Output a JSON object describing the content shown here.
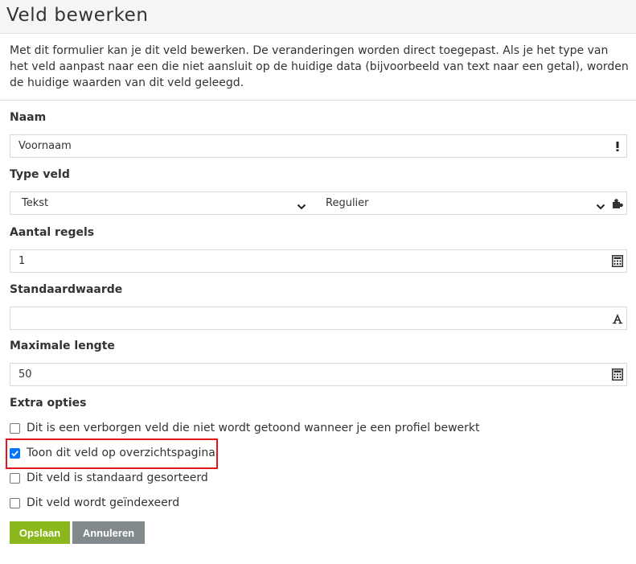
{
  "page": {
    "title": "Veld bewerken",
    "intro": "Met dit formulier kan je dit veld bewerken. De veranderingen worden direct toegepast. Als je het type van het veld aanpast naar een die niet aansluit op de huidige data (bijvoorbeeld van text naar een getal), worden de huidige waarden van dit veld geleegd."
  },
  "form": {
    "naam": {
      "label": "Naam",
      "value": "Voornaam",
      "icon": "exclamation-icon"
    },
    "type_veld": {
      "label": "Type veld",
      "type_value": "Tekst",
      "subtype_value": "Regulier",
      "icon": "puzzle-icon"
    },
    "aantal_regels": {
      "label": "Aantal regels",
      "value": "1",
      "icon": "calculator-icon"
    },
    "standaardwaarde": {
      "label": "Standaardwaarde",
      "value": "",
      "icon": "font-icon"
    },
    "maximale_lengte": {
      "label": "Maximale lengte",
      "value": "50",
      "icon": "calculator-icon"
    },
    "extra_opties": {
      "label": "Extra opties",
      "options": [
        {
          "label": "Dit is een verborgen veld die niet wordt getoond wanneer je een profiel bewerkt",
          "checked": false
        },
        {
          "label": "Toon dit veld op overzichtspagina",
          "checked": true
        },
        {
          "label": "Dit veld is standaard gesorteerd",
          "checked": false
        },
        {
          "label": "Dit veld wordt geïndexeerd",
          "checked": false
        }
      ]
    }
  },
  "buttons": {
    "save": "Opslaan",
    "cancel": "Annuleren"
  },
  "colors": {
    "save": "#8ab81c",
    "cancel": "#82898c",
    "highlight": "#e8141c",
    "checkbox": "#0075ff"
  }
}
